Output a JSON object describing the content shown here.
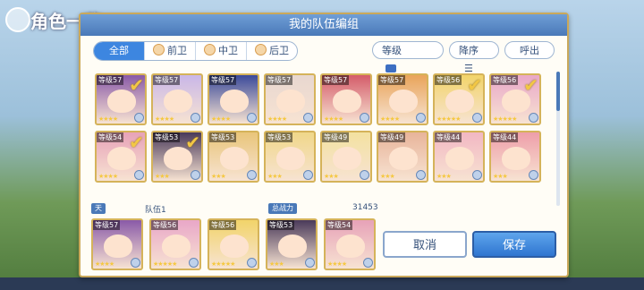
{
  "background": {
    "title": "角色一览"
  },
  "dialog": {
    "title": "我的队伍编组"
  },
  "tabs": [
    {
      "label": "全部",
      "active": true
    },
    {
      "label": "前卫",
      "active": false
    },
    {
      "label": "中卫",
      "active": false
    },
    {
      "label": "后卫",
      "active": false
    }
  ],
  "controls": {
    "sort_by": "等级",
    "order": "降序",
    "call_out": "呼出"
  },
  "roster": [
    {
      "level": "等级57",
      "stars": 4,
      "selected": true,
      "color": "#8a5aa8"
    },
    {
      "level": "等级57",
      "stars": 4,
      "selected": false,
      "color": "#c9b7e8"
    },
    {
      "level": "等级57",
      "stars": 4,
      "selected": false,
      "color": "#3b4a9a"
    },
    {
      "level": "等级57",
      "stars": 4,
      "selected": false,
      "color": "#e8d7d0"
    },
    {
      "level": "等级57",
      "stars": 4,
      "selected": false,
      "color": "#d45c6a"
    },
    {
      "level": "等级57",
      "stars": 4,
      "selected": false,
      "color": "#e9a45a"
    },
    {
      "level": "等级56",
      "stars": 5,
      "selected": true,
      "color": "#f2d46a"
    },
    {
      "level": "等级56",
      "stars": 5,
      "selected": true,
      "color": "#e9a7c8"
    },
    {
      "level": "等级54",
      "stars": 4,
      "selected": true,
      "color": "#e7a2b8"
    },
    {
      "level": "等级53",
      "stars": 3,
      "selected": true,
      "color": "#4a3a5a"
    },
    {
      "level": "等级53",
      "stars": 3,
      "selected": false,
      "color": "#e9c57a"
    },
    {
      "level": "等级53",
      "stars": 3,
      "selected": false,
      "color": "#f0d789"
    },
    {
      "level": "等级49",
      "stars": 3,
      "selected": false,
      "color": "#f3e1a0"
    },
    {
      "level": "等级49",
      "stars": 3,
      "selected": false,
      "color": "#e8b49a"
    },
    {
      "level": "等级44",
      "stars": 3,
      "selected": false,
      "color": "#f2b7c3"
    },
    {
      "level": "等级44",
      "stars": 3,
      "selected": false,
      "color": "#ee9ea9"
    }
  ],
  "party": {
    "leader_label": "天",
    "name": "队伍1",
    "power_label": "总战力",
    "power_value": "31453",
    "members": [
      {
        "level": "等级57",
        "stars": 4,
        "color": "#8a5aa8"
      },
      {
        "level": "等级56",
        "stars": 5,
        "color": "#e9a7c8"
      },
      {
        "level": "等级56",
        "stars": 5,
        "color": "#f2d46a"
      },
      {
        "level": "等级53",
        "stars": 3,
        "color": "#4a3a5a"
      },
      {
        "level": "等级54",
        "stars": 4,
        "color": "#e7a2b8"
      }
    ]
  },
  "buttons": {
    "cancel": "取消",
    "save": "保存"
  }
}
